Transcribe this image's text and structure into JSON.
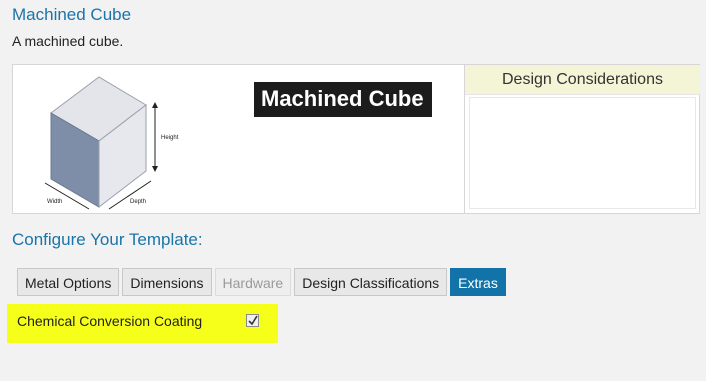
{
  "header": {
    "title": "Machined Cube",
    "description": "A machined cube."
  },
  "preview": {
    "banner": "Machined Cube",
    "dimension_labels": {
      "height": "Height",
      "width": "Width",
      "depth": "Depth"
    }
  },
  "design_considerations": {
    "title": "Design Considerations"
  },
  "configure": {
    "title": "Configure Your Template:",
    "tabs": [
      {
        "label": "Metal Options",
        "state": "normal"
      },
      {
        "label": "Dimensions",
        "state": "normal"
      },
      {
        "label": "Hardware",
        "state": "disabled"
      },
      {
        "label": "Design Classifications",
        "state": "normal"
      },
      {
        "label": "Extras",
        "state": "active"
      }
    ]
  },
  "extras": {
    "option_label": "Chemical Conversion Coating",
    "option_checked": true
  },
  "colors": {
    "accent": "#1a74a8",
    "active_tab": "#1173a8",
    "highlight": "#f6ff1a",
    "panel_header": "#f4f4d7"
  }
}
